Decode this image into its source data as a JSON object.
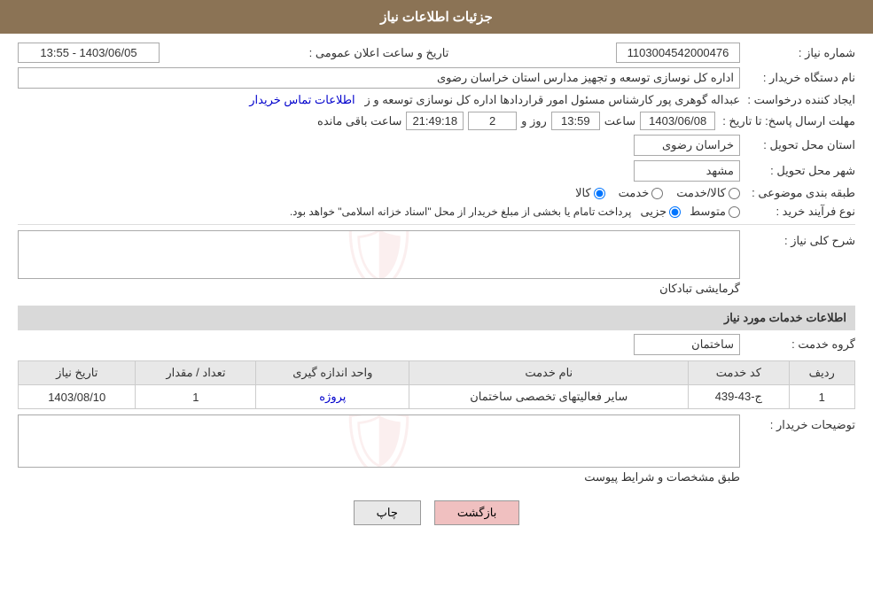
{
  "header": {
    "title": "جزئیات اطلاعات نیاز"
  },
  "fields": {
    "shomara_niaz_label": "شماره نیاز :",
    "shomara_niaz_value": "1103004542000476",
    "nam_dastasgah_label": "نام دستگاه خریدار :",
    "nam_dastasgah_value": "اداره کل نوسازی  توسعه و تجهیز مدارس استان خراسان رضوی",
    "ijad_konande_label": "ایجاد کننده درخواست :",
    "ijad_konande_value": "عبداله گوهری پور کارشناس مسئول امور قراردادها  اداره کل نوسازی  توسعه و ز",
    "ettelaat_tamas_link": "اطلاعات تماس خریدار",
    "mohlat_label": "مهلت ارسال پاسخ: تا تاریخ :",
    "date_value": "1403/06/08",
    "saat_label": "ساعت",
    "saat_value": "13:59",
    "rooz_label": "روز و",
    "rooz_value": "2",
    "countdown_value": "21:49:18",
    "baqi_mande_label": "ساعت باقی مانده",
    "ostan_label": "استان محل تحویل :",
    "ostan_value": "خراسان رضوی",
    "shahr_label": "شهر محل تحویل :",
    "shahr_value": "مشهد",
    "tabaqe_label": "طبقه بندی موضوعی :",
    "radio_kala": "کالا",
    "radio_khadamat": "خدمت",
    "radio_kala_khadamat": "کالا/خدمت",
    "now_farayand_label": "نوع فرآیند خرید :",
    "radio_jozi": "جزیی",
    "radio_mottavaset": "متوسط",
    "now_farayand_desc": "پرداخت تامام یا بخشی از مبلغ خریدار از محل \"اسناد خزانه اسلامی\" خواهد بود.",
    "taarikh_va_saat_label": "تاریخ و ساعت اعلان عمومی :",
    "taarikh_va_saat_value": "1403/06/05 - 13:55",
    "sharh_koli_label": "شرح کلی نیاز :",
    "sharh_koli_value": "گرمایشی تبادکان",
    "ettelaat_khadamat_header": "اطلاعات خدمات مورد نیاز",
    "goroh_khadamat_label": "گروه خدمت :",
    "goroh_khadamat_value": "ساختمان",
    "table": {
      "headers": [
        "ردیف",
        "کد خدمت",
        "نام خدمت",
        "واحد اندازه گیری",
        "تعداد / مقدار",
        "تاریخ نیاز"
      ],
      "rows": [
        {
          "radif": "1",
          "code": "ج-43-439",
          "name": "سایر فعالیتهای تخصصی ساختمان",
          "unit": "پروژه",
          "count": "1",
          "date": "1403/08/10"
        }
      ]
    },
    "توضیحات_label": "توضیحات خریدار :",
    "توضیحات_value": "طبق مشخصات و شرایط پیوست"
  },
  "buttons": {
    "print": "چاپ",
    "back": "بازگشت"
  }
}
